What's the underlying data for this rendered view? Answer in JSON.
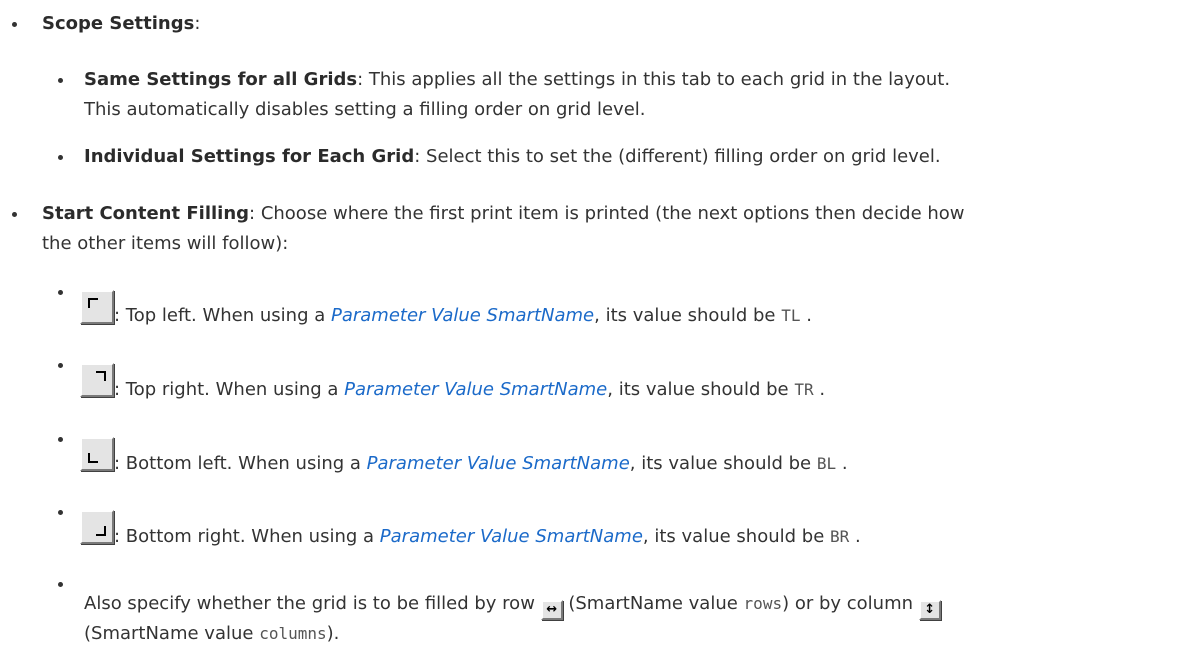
{
  "scope": {
    "title": "Scope Settings",
    "colon": ":",
    "same": {
      "title": "Same Settings for all Grids",
      "line1": ": This applies all the settings in this tab to each grid in the layout.",
      "line2": "This automatically disables setting a filling order on grid level."
    },
    "individual": {
      "title": "Individual Settings for Each Grid",
      "text": ": Select this to set the (different) filling order on grid level."
    }
  },
  "start": {
    "title": "Start Content Filling",
    "line1": ": Choose where the first print item is printed (the next options then decide how",
    "line2": "the other items will follow):",
    "link_text": "Parameter Value SmartName",
    "value_suffix": ", its value should be",
    "period": ".",
    "options": [
      {
        "icon": "top-left-corner-icon",
        "label": ": Top left. When using a ",
        "value": "TL"
      },
      {
        "icon": "top-right-corner-icon",
        "label": ": Top right. When using a ",
        "value": "TR"
      },
      {
        "icon": "bottom-left-corner-icon",
        "label": ": Bottom left. When using a ",
        "value": "BL"
      },
      {
        "icon": "bottom-right-corner-icon",
        "label": ": Bottom right. When using a ",
        "value": "BR"
      }
    ],
    "also": {
      "part1": "Also specify whether the grid is to be filled by row ",
      "part2": " (SmartName value ",
      "rows": "rows",
      "part3": ") or by column ",
      "part4": "(SmartName value ",
      "columns": "columns",
      "part5": ")."
    }
  }
}
